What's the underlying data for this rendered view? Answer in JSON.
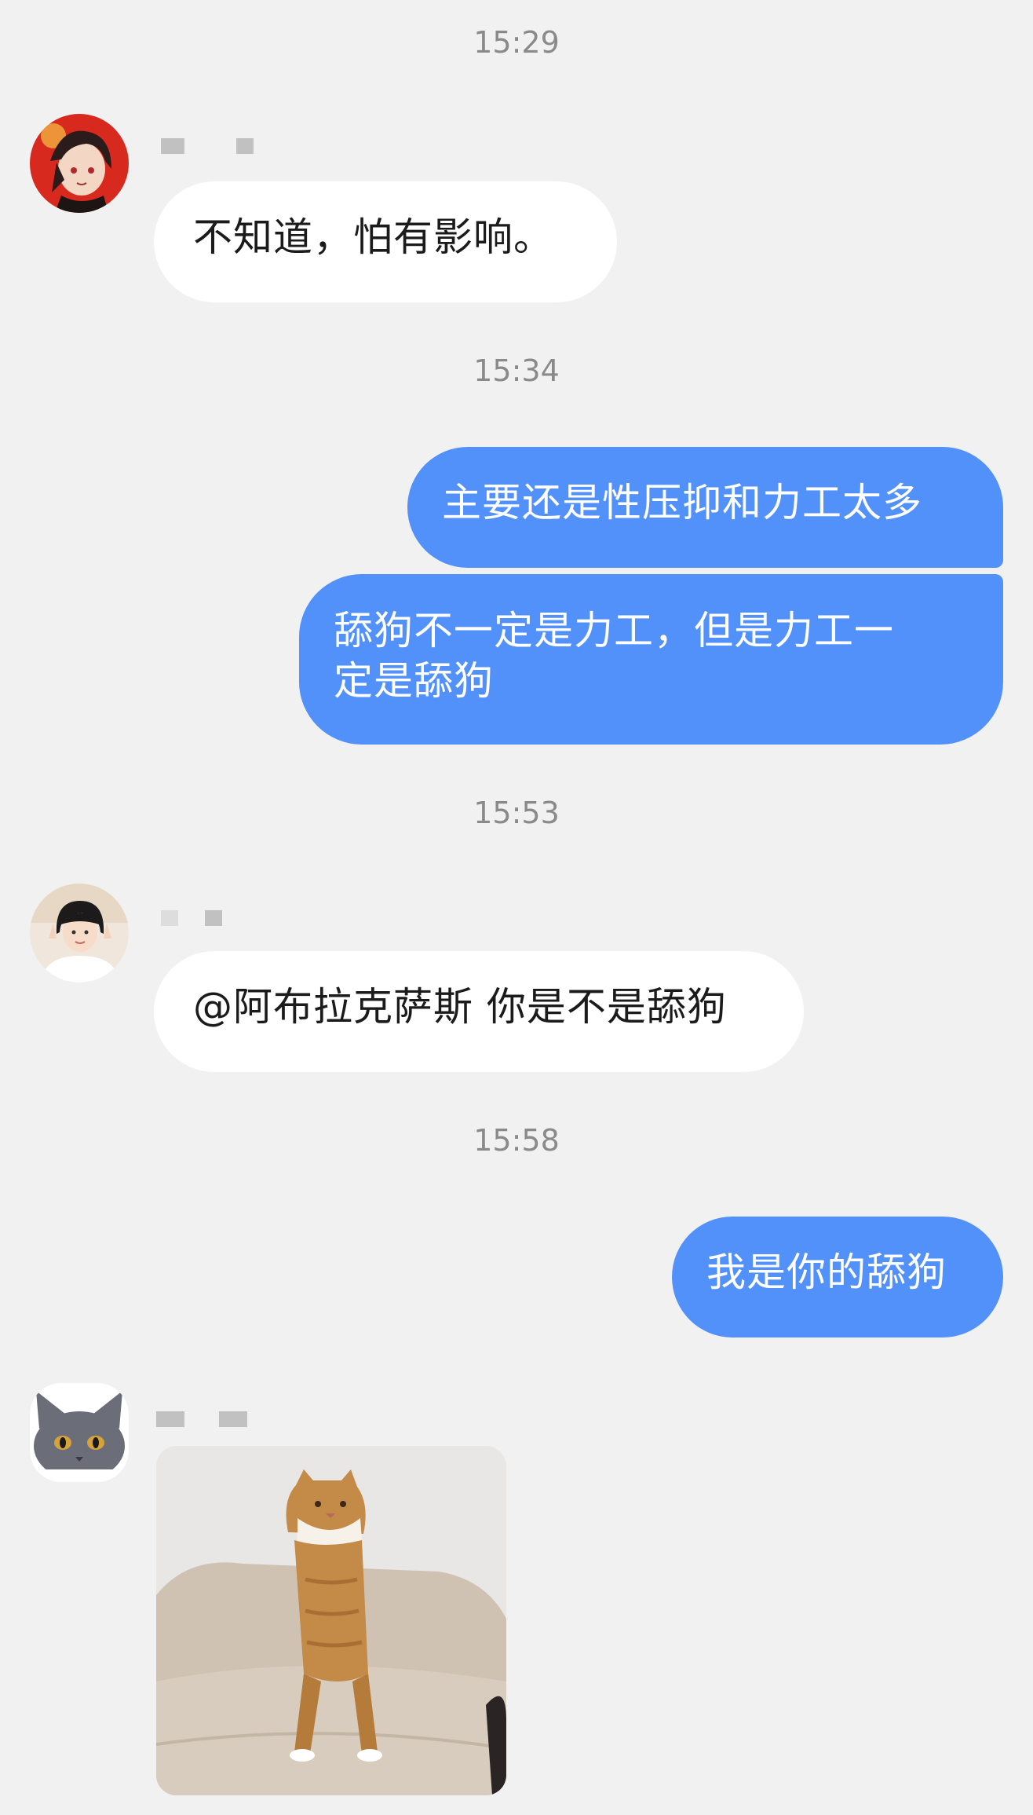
{
  "chat": {
    "timestamps": [
      "15:29",
      "15:34",
      "15:53",
      "15:58"
    ],
    "messages": [
      {
        "type": "incoming",
        "text": "不知道，怕有影响。"
      },
      {
        "type": "outgoing",
        "text": "主要还是性压抑和力工太多"
      },
      {
        "type": "outgoing",
        "line1": "舔狗不一定是力工，但是力工一",
        "line2": "定是舔狗"
      },
      {
        "type": "incoming",
        "text": "@阿布拉克萨斯 你是不是舔狗"
      },
      {
        "type": "outgoing",
        "text": "我是你的舔狗"
      },
      {
        "type": "incoming-image",
        "subject": "standing-cat-photo"
      }
    ]
  },
  "avatars": [
    "anime-character-avatar",
    "girl-photo-avatar",
    "grey-cat-avatar"
  ],
  "colors": {
    "background": "#f1f1f1",
    "incoming_bubble": "#ffffff",
    "outgoing_bubble": "#5290fa",
    "timestamp": "#8a8a8a"
  }
}
